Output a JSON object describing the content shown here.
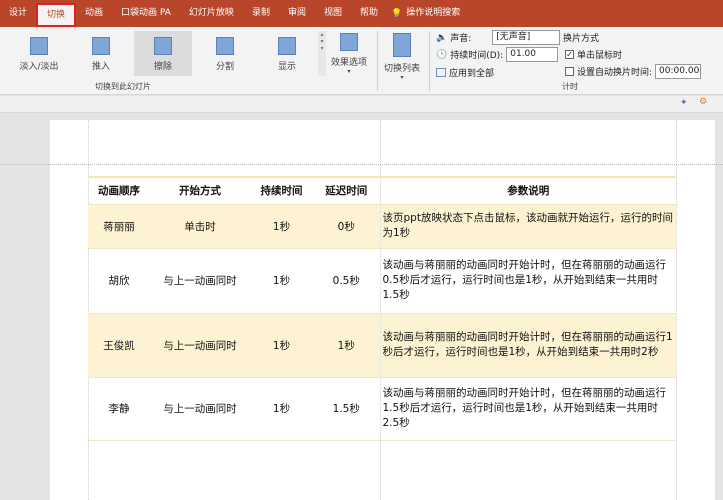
{
  "tabs": [
    "设计",
    "切换",
    "动画",
    "口袋动画 PA",
    "幻灯片放映",
    "录制",
    "审阅",
    "视图",
    "帮助",
    "操作说明搜索"
  ],
  "active_tab": "切换",
  "ribbon": {
    "transitions": [
      "淡入/淡出",
      "推入",
      "擦除",
      "分割",
      "显示"
    ],
    "selected": "擦除",
    "effect_options": "效果选项",
    "group1_label": "切换到此幻灯片",
    "switch_list": "切换列表",
    "sound_label": "声音:",
    "sound_value": "[无声音]",
    "duration_label": "持续时间(D):",
    "duration_value": "01.00",
    "apply_all": "应用到全部",
    "advance_title": "换片方式",
    "on_click": "单击鼠标时",
    "on_click_checked": true,
    "auto_after": "设置自动换片时间:",
    "auto_after_checked": false,
    "auto_value": "00:00.00",
    "timing_label": "计时"
  },
  "table": {
    "headers": [
      "动画顺序",
      "开始方式",
      "持续时间",
      "延迟时间",
      "参数说明"
    ],
    "rows": [
      [
        "蒋丽丽",
        "单击时",
        "1秒",
        "0秒",
        "该页ppt放映状态下点击鼠标，该动画就开始运行，运行的时间为1秒"
      ],
      [
        "胡欣",
        "与上一动画同时",
        "1秒",
        "0.5秒",
        "该动画与蒋丽丽的动画同时开始计时，但在蒋丽丽的动画运行0.5秒后才运行，运行时间也是1秒，从开始到结束一共用时1.5秒"
      ],
      [
        "王俊凯",
        "与上一动画同时",
        "1秒",
        "1秒",
        "该动画与蒋丽丽的动画同时开始计时，但在蒋丽丽的动画运行1秒后才运行，运行时间也是1秒，从开始到结束一共用时2秒"
      ],
      [
        "李静",
        "与上一动画同时",
        "1秒",
        "1.5秒",
        "该动画与蒋丽丽的动画同时开始计时，但在蒋丽丽的动画运行1.5秒后才运行，运行时间也是1秒，从开始到结束一共用时2.5秒"
      ]
    ]
  },
  "colors": {
    "ribbon_tab_bar": "#b9452b",
    "row_highlight": "#fdf2d2"
  }
}
